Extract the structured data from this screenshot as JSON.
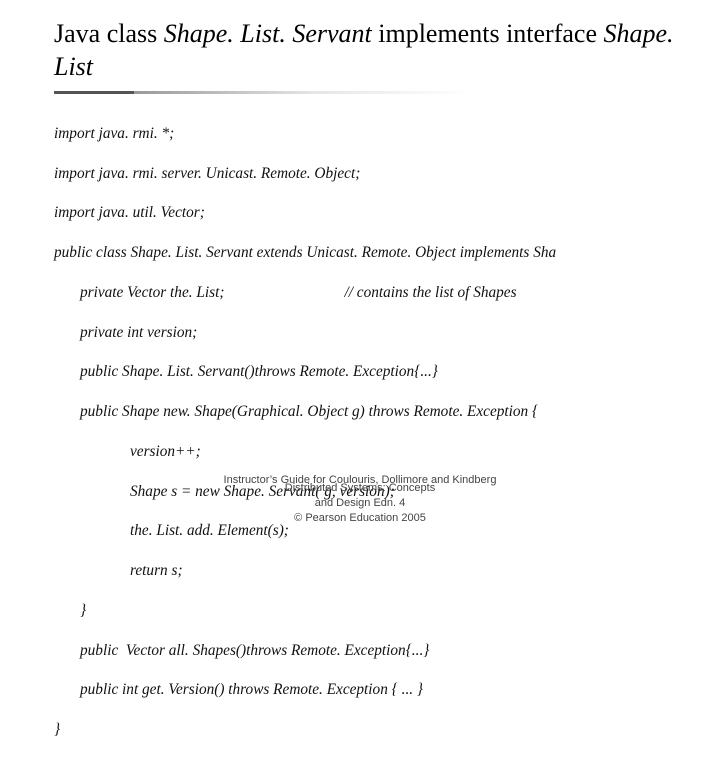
{
  "title": {
    "pre1": "Java class ",
    "ital1": "Shape. List. Servant",
    "mid": " implements interface ",
    "ital2": "Shape. List"
  },
  "code": {
    "l01": "import java. rmi. *;",
    "l02": "import java. rmi. server. Unicast. Remote. Object;",
    "l03": "import java. util. Vector;",
    "l04": "public class Shape. List. Servant extends Unicast. Remote. Object implements Sha",
    "l05a": "private Vector the. List;",
    "l05b": "// contains the list of Shapes",
    "l06": "private int version;",
    "l07": "public Shape. List. Servant()throws Remote. Exception{...}",
    "l08": "public Shape new. Shape(Graphical. Object g) throws Remote. Exception {",
    "l09": "version++;",
    "l10": "Shape s = new Shape. Servant( g, version);",
    "l11": "the. List. add. Element(s);",
    "l12": "return s;",
    "l13": "}",
    "l14": "public  Vector all. Shapes()throws Remote. Exception{...}",
    "l15": "public int get. Version() throws Remote. Exception { ... }",
    "l16": "}"
  },
  "footer": {
    "over1": "Instructor’s Guide for  Coulouris, Dollimore and Kindberg",
    "line1": "Distributed Systems: Concepts",
    "line2": "and Design   Edn. 4",
    "line3": "©   Pearson Education 2005"
  }
}
